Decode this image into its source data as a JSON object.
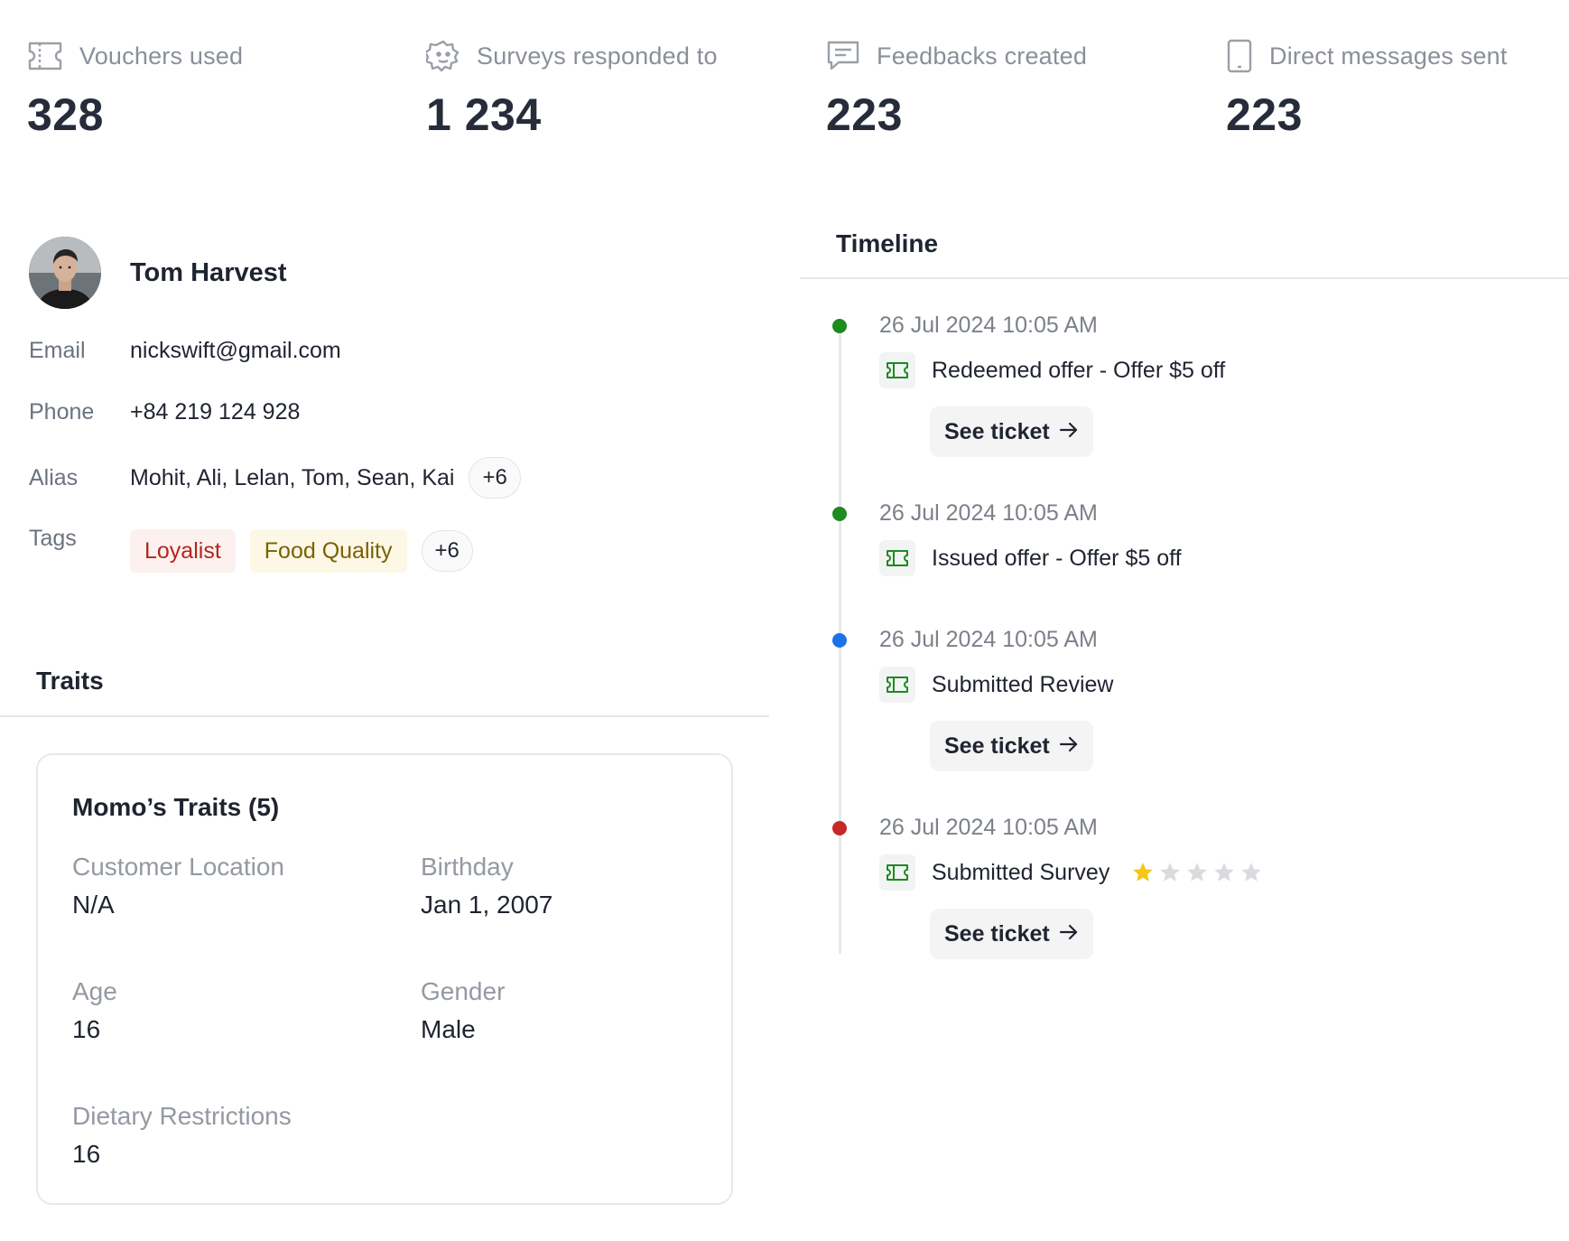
{
  "stats": [
    {
      "icon": "voucher-icon",
      "label": "Vouchers used",
      "value": "328"
    },
    {
      "icon": "survey-icon",
      "label": "Surveys responded to",
      "value": "1 234"
    },
    {
      "icon": "feedback-icon",
      "label": "Feedbacks created",
      "value": "223"
    },
    {
      "icon": "phone-icon",
      "label": "Direct messages sent",
      "value": "223"
    }
  ],
  "profile": {
    "name": "Tom Harvest",
    "email_label": "Email",
    "email": "nickswift@gmail.com",
    "phone_label": "Phone",
    "phone": "+84 219 124 928",
    "alias_label": "Alias",
    "alias": "Mohit, Ali, Lelan, Tom, Sean, Kai",
    "alias_more": "+6",
    "tags_label": "Tags",
    "tags": [
      {
        "label": "Loyalist",
        "color": "#b3261e"
      },
      {
        "label": "Food Quality",
        "color": "#7a6200"
      }
    ],
    "tags_more": "+6"
  },
  "traits": {
    "section_title": "Traits",
    "card_title": "Momo’s Traits (5)",
    "items": [
      {
        "label": "Customer Location",
        "value": "N/A"
      },
      {
        "label": "Birthday",
        "value": "Jan 1, 2007"
      },
      {
        "label": "Age",
        "value": "16"
      },
      {
        "label": "Gender",
        "value": "Male"
      },
      {
        "label": "Dietary Restrictions",
        "value": "16"
      }
    ]
  },
  "timeline": {
    "title": "Timeline",
    "see_ticket_label": "See ticket",
    "events": [
      {
        "time": "26 Jul 2024 10:05 AM",
        "label": "Redeemed offer - Offer $5 off",
        "dot_color": "#1f8a1f",
        "has_ticket": true
      },
      {
        "time": "26 Jul 2024 10:05 AM",
        "label": "Issued offer - Offer $5 off",
        "dot_color": "#1f8a1f",
        "has_ticket": false
      },
      {
        "time": "26 Jul 2024 10:05 AM",
        "label": "Submitted Review",
        "dot_color": "#1a73e8",
        "has_ticket": true
      },
      {
        "time": "26 Jul 2024 10:05 AM",
        "label": "Submitted Survey",
        "dot_color": "#c62828",
        "has_ticket": true,
        "rating": 1,
        "rating_max": 5
      }
    ]
  },
  "colors": {
    "accent_green": "#1f8a1f",
    "star_filled": "#f5c518",
    "star_empty": "#d9dbde"
  }
}
